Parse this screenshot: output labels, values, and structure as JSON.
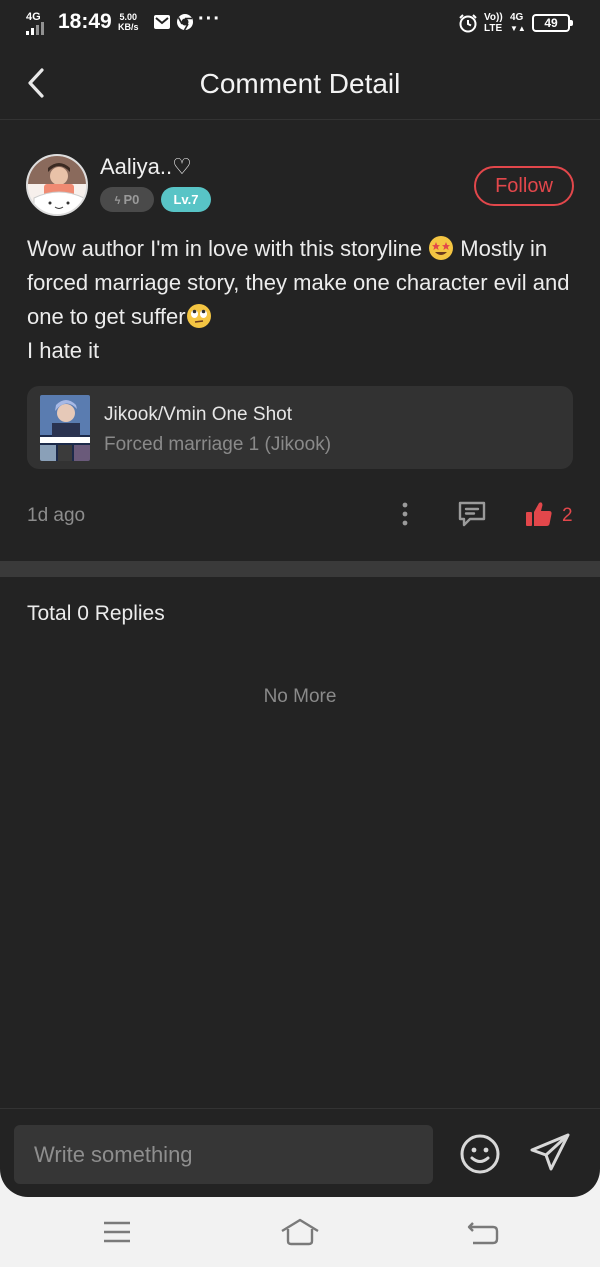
{
  "status_bar": {
    "network_left": "4G",
    "time": "18:49",
    "speed_value": "5.00",
    "speed_unit": "KB/s",
    "more": "···",
    "volte": "Vo))",
    "lte": "LTE",
    "network_right": "4G",
    "battery": "49"
  },
  "header": {
    "title": "Comment Detail"
  },
  "comment": {
    "username": "Aaliya..♡",
    "points_badge": "P0",
    "level_badge": "Lv.7",
    "follow_label": "Follow",
    "text_line1_a": "Wow author I'm in love with this storyline ",
    "text_line1_b": " Mostly in forced marriage story, they make one character evil and one to get suffer",
    "text_line2": "I hate it",
    "time_ago": "1d ago",
    "like_count": "2"
  },
  "book": {
    "title": "Jikook/Vmin One Shot",
    "chapter": "Forced marriage 1 (Jikook)"
  },
  "replies": {
    "total_label": "Total 0 Replies",
    "no_more": "No More"
  },
  "input": {
    "placeholder": "Write something"
  },
  "colors": {
    "background": "#232323",
    "accent_red": "#e2474b",
    "level_teal": "#58c4c6"
  }
}
